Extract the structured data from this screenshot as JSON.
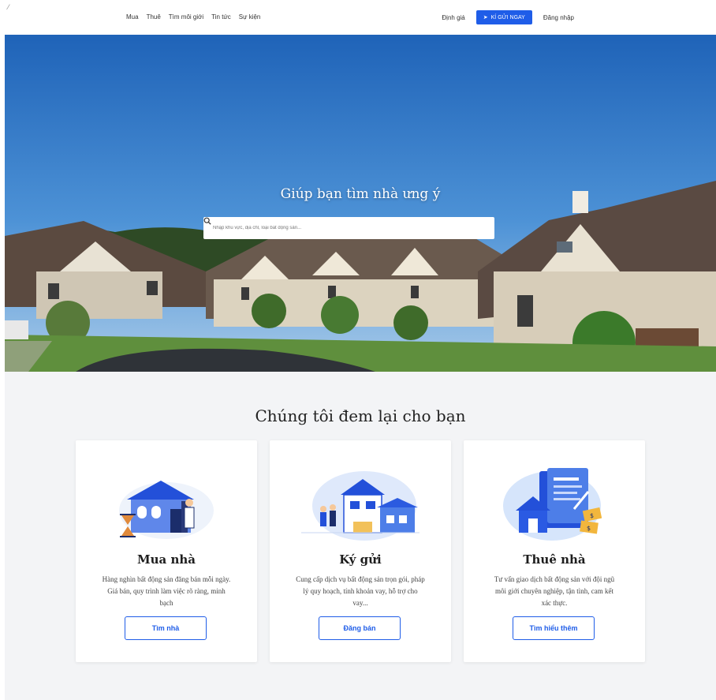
{
  "nav": {
    "corner_glyph": "⁄",
    "links": [
      "Mua",
      "Thuê",
      "Tìm môi giới",
      "Tin tức",
      "Sự kiện"
    ],
    "right_links": {
      "pricing": "Định giá",
      "cta": "KÍ GỬI NGAY",
      "login": "Đăng nhập"
    }
  },
  "hero": {
    "title": "Giúp bạn tìm nhà ưng ý",
    "search_placeholder": "Nhập khu vực, địa chỉ, loại bất động sản..."
  },
  "section": {
    "title": "Chúng tôi đem lại cho bạn",
    "cards": [
      {
        "title": "Mua nhà",
        "desc": "Hàng nghìn bất động sản đăng bán mỗi ngày. Giá bán, quy trình làm việc rõ ràng, minh bạch",
        "button": "Tìm nhà",
        "icon": "house-buying-illustration"
      },
      {
        "title": "Ký gửi",
        "desc": "Cung cấp dịch vụ bất động sản trọn gói, pháp lý quy hoạch, tính khoản vay, hỗ trợ cho vay...",
        "button": "Đăng bán",
        "icon": "house-consignment-illustration"
      },
      {
        "title": "Thuê nhà",
        "desc": "Tư vấn giao dịch bất động sản với đội ngũ môi giới chuyên nghiệp, tận tình, cam kết xác thực.",
        "button": "Tìm hiểu thêm",
        "icon": "rental-contract-illustration"
      }
    ]
  },
  "colors": {
    "accent": "#1f5de8",
    "section_bg": "#f3f4f6"
  }
}
